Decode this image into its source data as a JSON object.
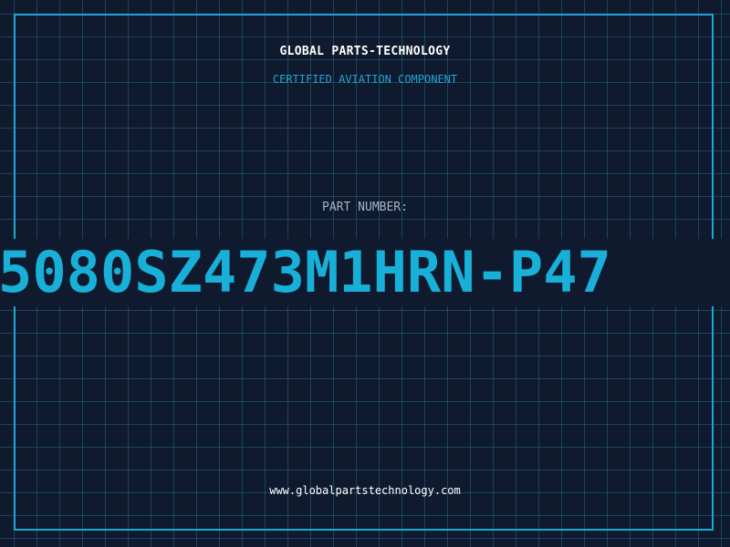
{
  "header": {
    "brand": "GLOBAL PARTS-TECHNOLOGY",
    "subtitle": "CERTIFIED AVIATION COMPONENT"
  },
  "part": {
    "label": "PART NUMBER:",
    "number": "5080SZ473M1HRN-P47"
  },
  "footer": {
    "url": "www.globalpartstechnology.com"
  },
  "colors": {
    "background": "#0f1a2e",
    "grid": "#28789a",
    "accent": "#1da8d4",
    "part_number": "#18b0d8",
    "text": "#ffffff",
    "muted_text": "#a8b4c4"
  }
}
